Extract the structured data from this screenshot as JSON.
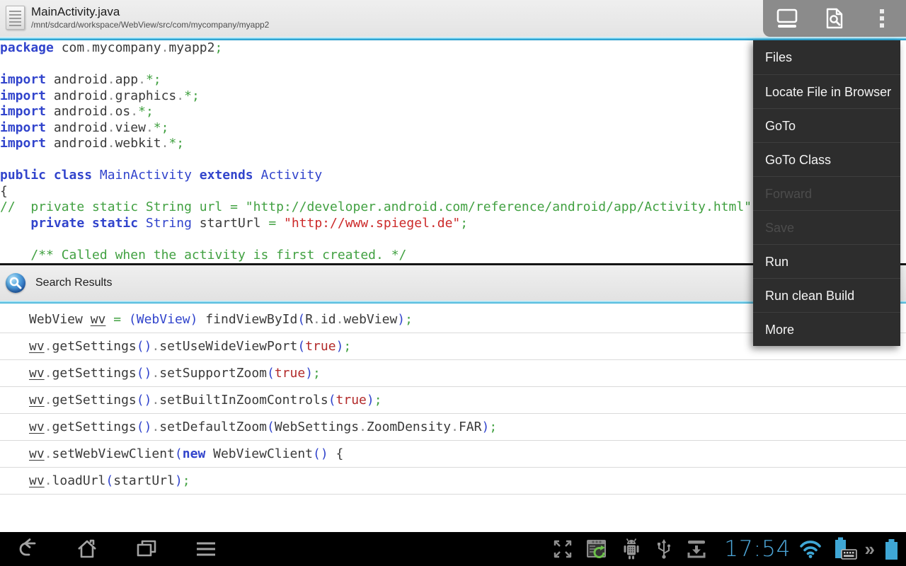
{
  "colors": {
    "accent_blue": "#33b5e5",
    "menu_bg": "#2d2d2d",
    "topbar_bg": "#e9e9e9",
    "keyword_blue": "#3144cc",
    "comment_green": "#42a142",
    "string_red": "#cc2929",
    "navbar_bg": "#000000",
    "status_blue": "#4da7d9"
  },
  "topbar": {
    "title": "MainActivity.java",
    "path": "/mnt/sdcard/workspace/WebView/src/com/mycompany/myapp2",
    "icons": [
      "document-icon",
      "keyboard-icon",
      "file-search-icon",
      "overflow-icon"
    ]
  },
  "menu": {
    "items": [
      {
        "label": "Files",
        "enabled": true
      },
      {
        "label": "Locate File in Browser",
        "enabled": true
      },
      {
        "label": "GoTo",
        "enabled": true
      },
      {
        "label": "GoTo Class",
        "enabled": true
      },
      {
        "label": "Forward",
        "enabled": false
      },
      {
        "label": "Save",
        "enabled": false
      },
      {
        "label": "Run",
        "enabled": true
      },
      {
        "label": "Run clean Build",
        "enabled": true
      },
      {
        "label": "More",
        "enabled": true
      }
    ]
  },
  "editor": {
    "lines": [
      [
        [
          "kw",
          "package"
        ],
        [
          "pln",
          " com"
        ],
        [
          "dot",
          "."
        ],
        [
          "pln",
          "mycompany"
        ],
        [
          "dot",
          "."
        ],
        [
          "pln",
          "myapp2"
        ],
        [
          "opr",
          ";"
        ]
      ],
      [],
      [
        [
          "kw",
          "import"
        ],
        [
          "pln",
          " android"
        ],
        [
          "dot",
          "."
        ],
        [
          "pln",
          "app"
        ],
        [
          "dot",
          "."
        ],
        [
          "opr",
          "*;"
        ]
      ],
      [
        [
          "kw",
          "import"
        ],
        [
          "pln",
          " android"
        ],
        [
          "dot",
          "."
        ],
        [
          "pln",
          "graphics"
        ],
        [
          "dot",
          "."
        ],
        [
          "opr",
          "*;"
        ]
      ],
      [
        [
          "kw",
          "import"
        ],
        [
          "pln",
          " android"
        ],
        [
          "dot",
          "."
        ],
        [
          "pln",
          "os"
        ],
        [
          "dot",
          "."
        ],
        [
          "opr",
          "*;"
        ]
      ],
      [
        [
          "kw",
          "import"
        ],
        [
          "pln",
          " android"
        ],
        [
          "dot",
          "."
        ],
        [
          "pln",
          "view"
        ],
        [
          "dot",
          "."
        ],
        [
          "opr",
          "*;"
        ]
      ],
      [
        [
          "kw",
          "import"
        ],
        [
          "pln",
          " android"
        ],
        [
          "dot",
          "."
        ],
        [
          "pln",
          "webkit"
        ],
        [
          "dot",
          "."
        ],
        [
          "opr",
          "*;"
        ]
      ],
      [],
      [
        [
          "kw",
          "public class"
        ],
        [
          "typ",
          " MainActivity"
        ],
        [
          "kw",
          " extends"
        ],
        [
          "typ",
          " Activity"
        ]
      ],
      [
        [
          "pln",
          "{"
        ]
      ],
      [
        [
          "com",
          "//  private static String url = \"http://developer.android.com/reference/android/app/Activity.html\";"
        ]
      ],
      [
        [
          "pln",
          "    "
        ],
        [
          "kw",
          "private static"
        ],
        [
          "typ",
          " String"
        ],
        [
          "pln",
          " startUrl "
        ],
        [
          "opr",
          "="
        ],
        [
          "pln",
          " "
        ],
        [
          "str",
          "\"http://www.spiegel.de\""
        ],
        [
          "opr",
          ";"
        ]
      ],
      [],
      [
        [
          "pln",
          "    "
        ],
        [
          "com",
          "/** Called when the activity is first created. */"
        ]
      ]
    ]
  },
  "search_panel": {
    "title": "Search Results",
    "icon": "search-sphere-icon",
    "rows": [
      [
        [
          "pln",
          "WebView "
        ],
        [
          "und",
          "wv"
        ],
        [
          "pln",
          " "
        ],
        [
          "opr",
          "="
        ],
        [
          "pln",
          " "
        ],
        [
          "par",
          "(WebView)"
        ],
        [
          "pln",
          " findViewById"
        ],
        [
          "par",
          "("
        ],
        [
          "pln",
          "R"
        ],
        [
          "dot",
          "."
        ],
        [
          "pln",
          "id"
        ],
        [
          "dot",
          "."
        ],
        [
          "pln",
          "webView"
        ],
        [
          "par",
          ")"
        ],
        [
          "opr",
          ";"
        ]
      ],
      [
        [
          "und",
          "wv"
        ],
        [
          "dot",
          "."
        ],
        [
          "pln",
          "getSettings"
        ],
        [
          "par",
          "()"
        ],
        [
          "dot",
          "."
        ],
        [
          "pln",
          "setUseWideViewPort"
        ],
        [
          "par",
          "("
        ],
        [
          "lit",
          "true"
        ],
        [
          "par",
          ")"
        ],
        [
          "opr",
          ";"
        ]
      ],
      [
        [
          "und",
          "wv"
        ],
        [
          "dot",
          "."
        ],
        [
          "pln",
          "getSettings"
        ],
        [
          "par",
          "()"
        ],
        [
          "dot",
          "."
        ],
        [
          "pln",
          "setSupportZoom"
        ],
        [
          "par",
          "("
        ],
        [
          "lit",
          "true"
        ],
        [
          "par",
          ")"
        ],
        [
          "opr",
          ";"
        ]
      ],
      [
        [
          "und",
          "wv"
        ],
        [
          "dot",
          "."
        ],
        [
          "pln",
          "getSettings"
        ],
        [
          "par",
          "()"
        ],
        [
          "dot",
          "."
        ],
        [
          "pln",
          "setBuiltInZoomControls"
        ],
        [
          "par",
          "("
        ],
        [
          "lit",
          "true"
        ],
        [
          "par",
          ")"
        ],
        [
          "opr",
          ";"
        ]
      ],
      [
        [
          "und",
          "wv"
        ],
        [
          "dot",
          "."
        ],
        [
          "pln",
          "getSettings"
        ],
        [
          "par",
          "()"
        ],
        [
          "dot",
          "."
        ],
        [
          "pln",
          "setDefaultZoom"
        ],
        [
          "par",
          "("
        ],
        [
          "pln",
          "WebSettings"
        ],
        [
          "dot",
          "."
        ],
        [
          "pln",
          "ZoomDensity"
        ],
        [
          "dot",
          "."
        ],
        [
          "pln",
          "FAR"
        ],
        [
          "par",
          ")"
        ],
        [
          "opr",
          ";"
        ]
      ],
      [
        [
          "und",
          "wv"
        ],
        [
          "dot",
          "."
        ],
        [
          "pln",
          "setWebViewClient"
        ],
        [
          "par",
          "("
        ],
        [
          "kw",
          "new"
        ],
        [
          "pln",
          " WebViewClient"
        ],
        [
          "par",
          "()"
        ],
        [
          "pln",
          " {"
        ]
      ],
      [
        [
          "und",
          "wv"
        ],
        [
          "dot",
          "."
        ],
        [
          "pln",
          "loadUrl"
        ],
        [
          "par",
          "("
        ],
        [
          "pln",
          "startUrl"
        ],
        [
          "par",
          ")"
        ],
        [
          "opr",
          ";"
        ]
      ]
    ]
  },
  "navbar": {
    "time": "17:54",
    "left_icons": [
      "back-icon",
      "home-icon",
      "recents-icon",
      "menu-bars-icon"
    ],
    "status_icons": [
      "expand-icon",
      "app-sync-icon",
      "android-debug-icon",
      "usb-icon",
      "tray-download-icon",
      "wifi-icon",
      "battery-keyboard-icon",
      "chevrons-icon",
      "battery-icon"
    ]
  }
}
